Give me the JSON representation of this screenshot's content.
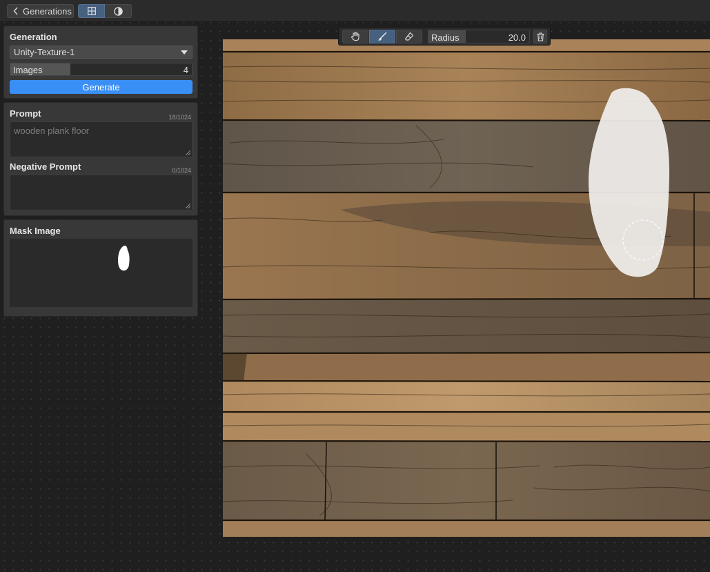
{
  "topbar": {
    "back_label": "Generations",
    "views": [
      {
        "icon": "grid-icon",
        "active": true
      },
      {
        "icon": "half-circle-icon",
        "active": false
      }
    ]
  },
  "generation": {
    "title": "Generation",
    "model": "Unity-Texture-1",
    "images_label": "Images",
    "images_value": "4",
    "images_fill_fraction": 0.33,
    "generate_label": "Generate"
  },
  "prompt": {
    "title": "Prompt",
    "counter": "18/1024",
    "value": "wooden plank floor",
    "negative_title": "Negative Prompt",
    "negative_counter": "0/1024",
    "negative_value": ""
  },
  "mask": {
    "title": "Mask Image"
  },
  "toolbar": {
    "tools": [
      {
        "icon": "hand-icon",
        "active": false
      },
      {
        "icon": "brush-icon",
        "active": true
      },
      {
        "icon": "eraser-icon",
        "active": false
      }
    ],
    "radius_label": "Radius",
    "radius_value": "20.0",
    "delete_icon": "trash-icon"
  },
  "colors": {
    "accent": "#3a8ff7",
    "active_tool": "#46607f",
    "panel_bg": "#383838",
    "mask_white": "#ffffff"
  }
}
